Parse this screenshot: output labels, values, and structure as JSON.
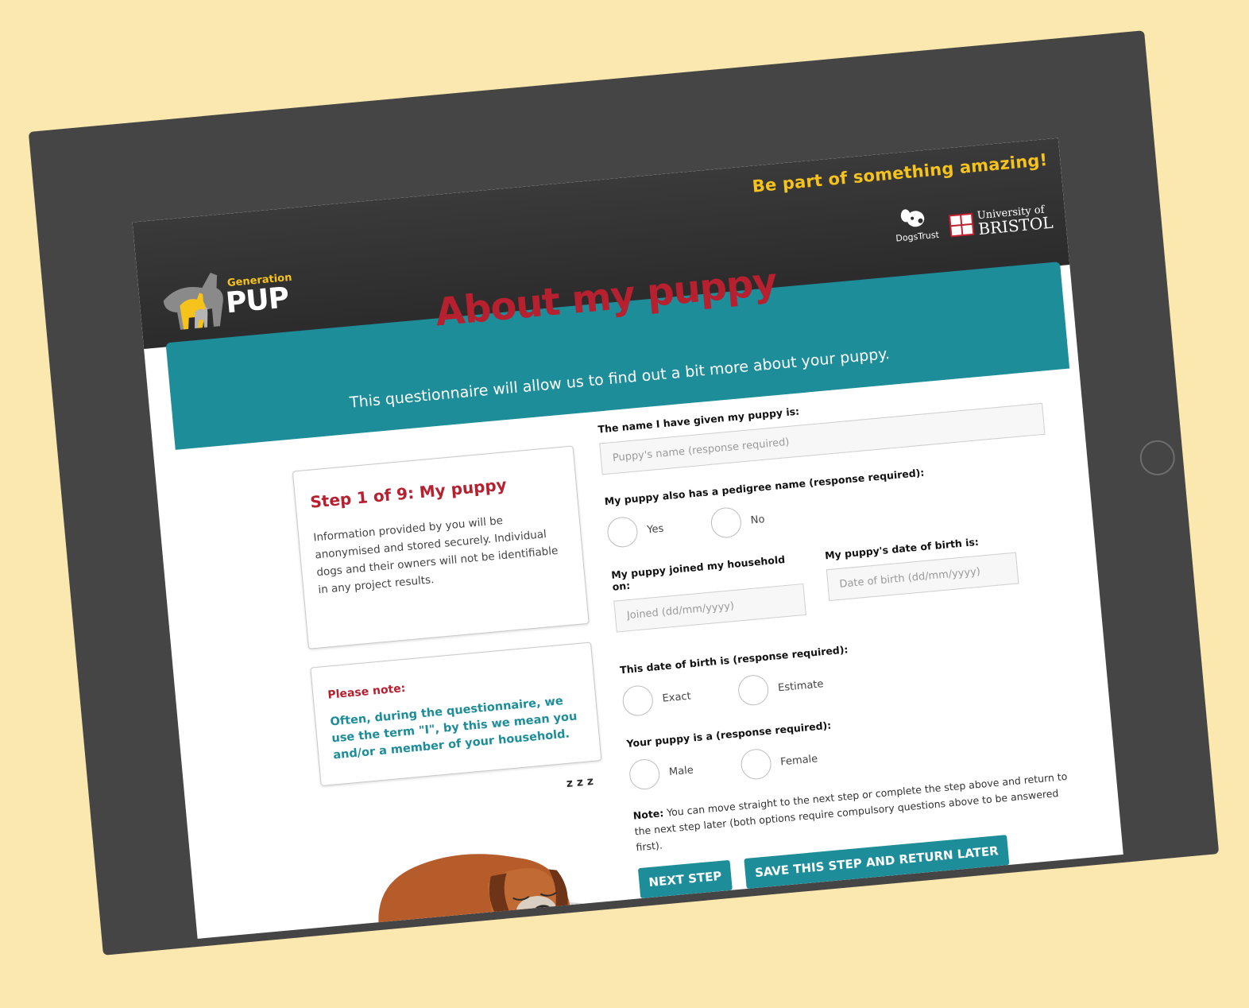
{
  "header": {
    "tagline": "Be part of something amazing!",
    "logo_gen": "Generation",
    "logo_pup": "PUP",
    "partner1": "DogsTrust",
    "partner2_line1": "University of",
    "partner2_line2": "BRISTOL"
  },
  "page": {
    "title": "About my puppy",
    "intro": "This questionnaire will allow us to find out a bit more about your puppy."
  },
  "sidebar": {
    "step_title": "Step 1 of 9: My puppy",
    "info": "Information provided by you will be anonymised and stored securely. Individual dogs and their owners will not be identifiable in any project results.",
    "note_title": "Please note:",
    "note_text": "Often, during the questionnaire, we use the term \"I\", by this we mean you and/or a member of your household."
  },
  "form": {
    "name_label": "The name I have given my puppy is:",
    "name_placeholder": "Puppy's name (response required)",
    "pedigree_label": "My puppy also has a pedigree name (response required):",
    "pedigree_yes": "Yes",
    "pedigree_no": "No",
    "joined_label": "My puppy joined my household on:",
    "joined_placeholder": "Joined (dd/mm/yyyy)",
    "dob_label": "My puppy's date of birth is:",
    "dob_placeholder": "Date of birth (dd/mm/yyyy)",
    "dob_type_label": "This date of birth is (response required):",
    "dob_exact": "Exact",
    "dob_estimate": "Estimate",
    "sex_label": "Your puppy is a (response required):",
    "sex_male": "Male",
    "sex_female": "Female",
    "note_bold": "Note:",
    "note_text": " You can move straight to the next step or complete the step above and return to the next step later (both options require compulsory questions above to be answered first).",
    "next_button": "NEXT STEP",
    "save_button": "SAVE THIS STEP AND RETURN LATER"
  },
  "illustration": {
    "zzz": "z z z"
  },
  "colors": {
    "accent": "#1e8d9a",
    "brand_red": "#b6202f",
    "tagline_yellow": "#f6c21c",
    "background": "#fbe8ae",
    "device": "#454545"
  },
  "icons": [
    "generation-pup-logo-icon",
    "dogs-trust-logo-icon",
    "bristol-crest-icon",
    "sleeping-puppy-icon",
    "home-button-icon"
  ]
}
